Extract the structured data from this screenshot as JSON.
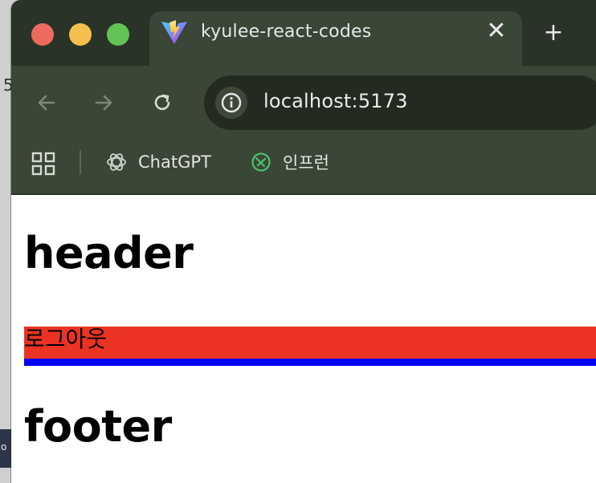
{
  "desktop": {
    "left_glyph": "5",
    "bottom_fragment": "o"
  },
  "browser": {
    "tab": {
      "title": "kyulee-react-codes",
      "icon": "vite-logo-icon",
      "close_label": "✕"
    },
    "new_tab_label": "+",
    "address_bar": {
      "url": "localhost:5173",
      "site_info_icon": "info-icon"
    },
    "bookmarks": [
      {
        "label": "ChatGPT",
        "icon": "openai-icon"
      },
      {
        "label": "인프런",
        "icon": "inflearn-icon"
      }
    ],
    "colors": {
      "frame": "#2a3328",
      "toolbar": "#3a4636",
      "omnibox": "#232b21"
    }
  },
  "page": {
    "header_text": "header",
    "logout_text": "로그아웃",
    "footer_text": "footer",
    "colors": {
      "logout_bg": "#ea3323",
      "blue_bar": "#0000f5"
    }
  }
}
